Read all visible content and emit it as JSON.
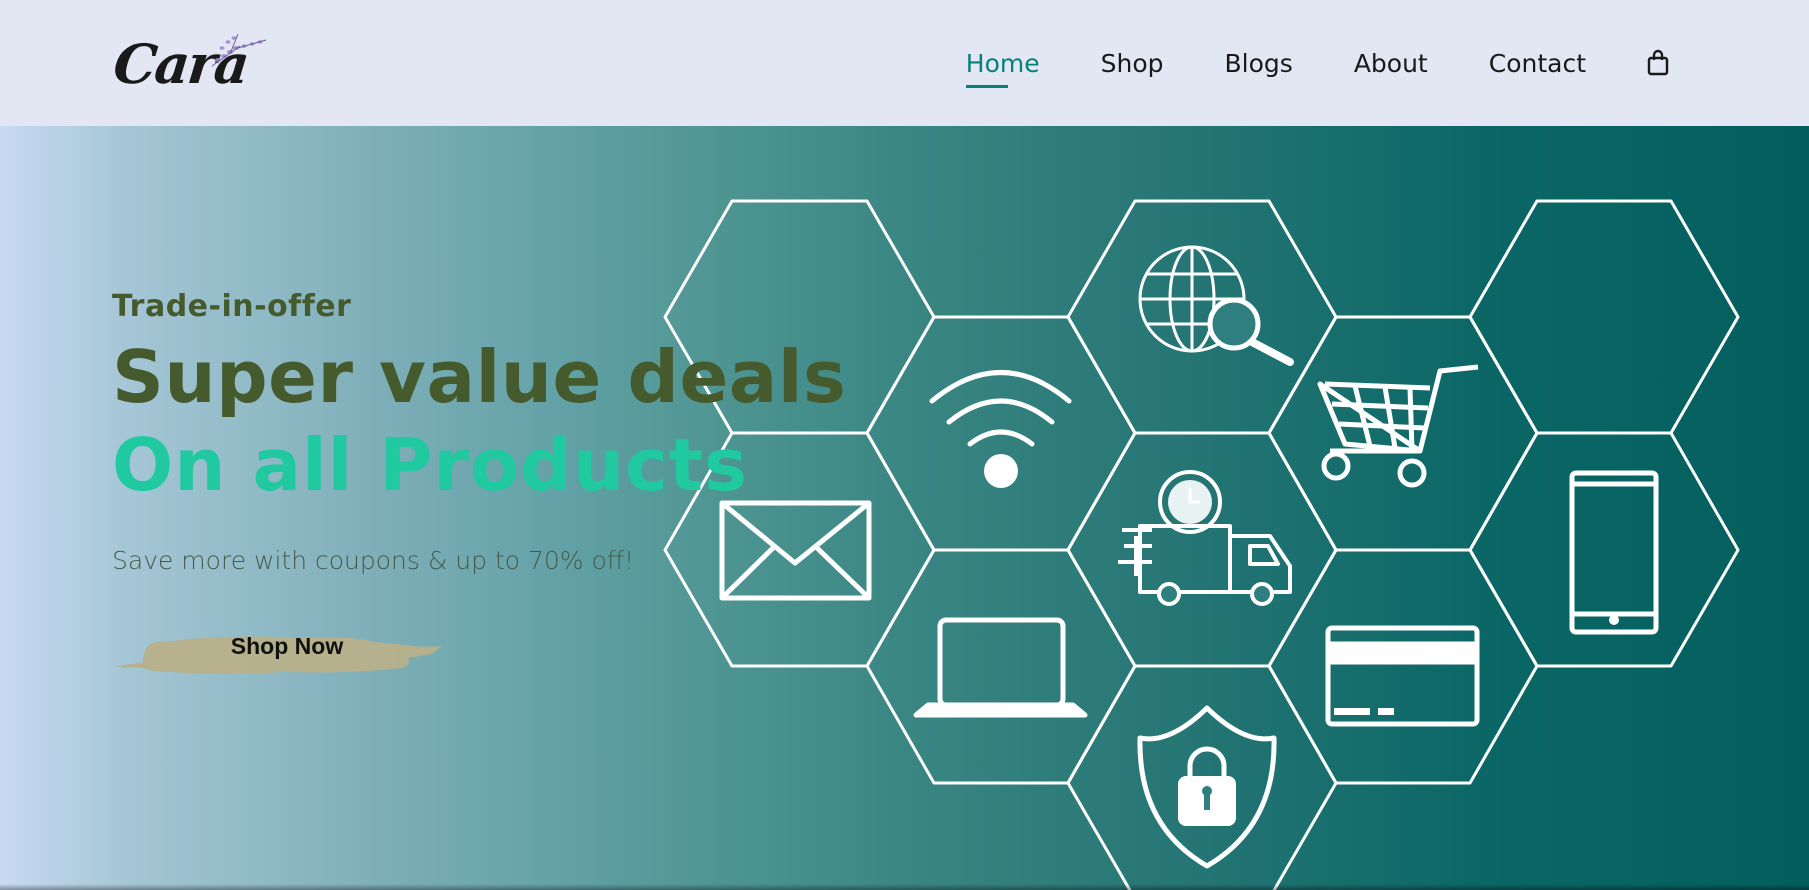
{
  "header": {
    "logo_text": "Cara",
    "nav": [
      {
        "label": "Home",
        "active": true
      },
      {
        "label": "Shop",
        "active": false
      },
      {
        "label": "Blogs",
        "active": false
      },
      {
        "label": "About",
        "active": false
      },
      {
        "label": "Contact",
        "active": false
      }
    ],
    "cart_icon": "shopping-bag-icon"
  },
  "hero": {
    "eyebrow": "Trade-in-offer",
    "headline": "Super value deals",
    "headline_accent": "On all Products",
    "subtext": "Save more with coupons & up to 70% off!",
    "cta_label": "Shop Now",
    "icons": [
      "wifi-icon",
      "globe-search-icon",
      "shopping-cart-icon",
      "envelope-icon",
      "delivery-truck-icon",
      "smartphone-icon",
      "laptop-icon",
      "credit-card-icon",
      "security-shield-icon"
    ]
  },
  "colors": {
    "accent": "#088178",
    "headline": "#465b2d",
    "headline_accent": "#20c9a0",
    "header_bg": "#e3e6f3",
    "cta_bg": "#b8b08a"
  }
}
